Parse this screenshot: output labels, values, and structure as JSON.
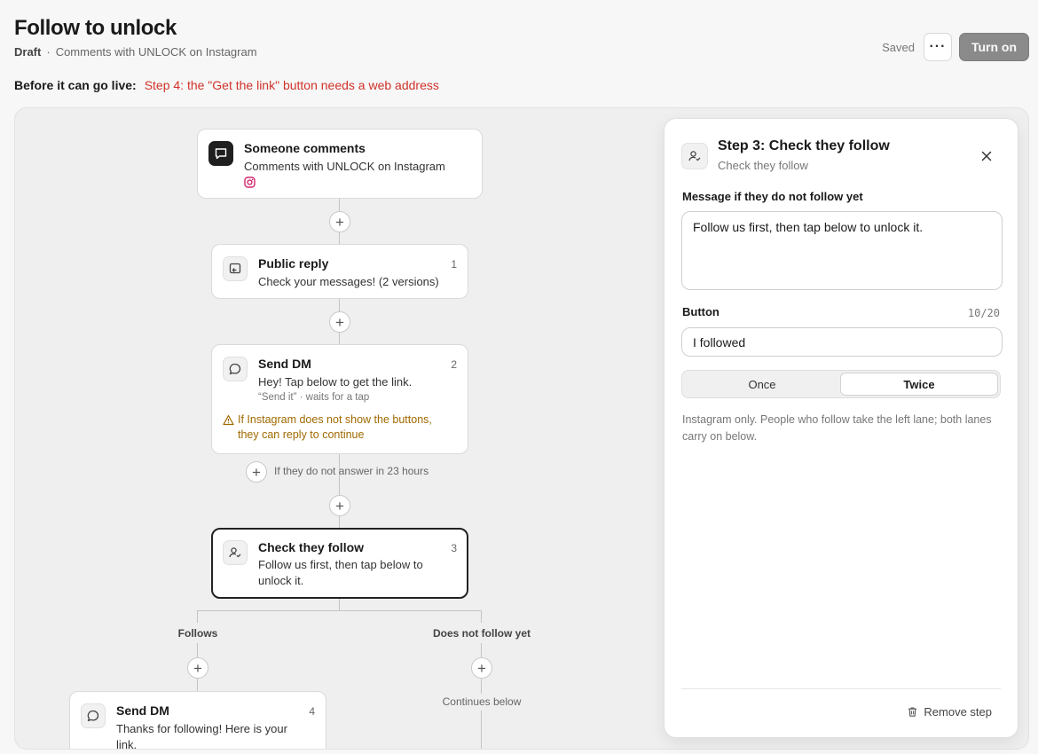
{
  "header": {
    "title": "Follow to unlock",
    "status": "Draft",
    "separator": "·",
    "subtitle": "Comments with UNLOCK on Instagram",
    "saved_label": "Saved",
    "more_label": "···",
    "turn_on_label": "Turn on"
  },
  "live_check": {
    "label": "Before it can go live:",
    "warning": "Step 4: the \"Get the link\" button needs a web address"
  },
  "flow": {
    "trigger": {
      "title": "Someone comments",
      "description": "Comments with UNLOCK on Instagram",
      "icon": "chat-icon"
    },
    "steps": [
      {
        "title": "Public reply",
        "number": "1",
        "description": "Check your messages! (2 versions)"
      },
      {
        "title": "Send DM",
        "number": "2",
        "description": "Hey! Tap below to get the link.",
        "meta": "“Send it” · waits for a tap",
        "note": "If Instagram does not show the buttons, they can reply to continue"
      },
      {
        "title": "Check they follow",
        "number": "3",
        "description_line1": "Follow us first, then tap below to",
        "description_line2": "unlock it."
      },
      {
        "title": "Send DM",
        "number": "4",
        "description_line1": "Thanks for following! Here is your",
        "description_line2": "link."
      }
    ],
    "timeout_label": "If they do not answer in 23 hours",
    "branch_follows": "Follows",
    "branch_not_follow": "Does not follow yet",
    "continues_label": "Continues below"
  },
  "panel": {
    "title": "Step 3: Check they follow",
    "subtitle": "Check they follow",
    "message_label": "Message if they do not follow yet",
    "message_value": "Follow us first, then tap below to unlock it.",
    "button_label": "Button",
    "button_counter": "10/20",
    "button_value": "I followed",
    "options": [
      "Once",
      "Twice"
    ],
    "selected_option": "Twice",
    "help_text": "Instagram only. People who follow take the left lane; both lanes carry on below.",
    "remove_label": "Remove step"
  },
  "colors": {
    "warning_red": "#d0322a",
    "note_amber": "#a06a00",
    "instagram": "#d6246e",
    "turn_on_bg": "#8a8a8a"
  }
}
